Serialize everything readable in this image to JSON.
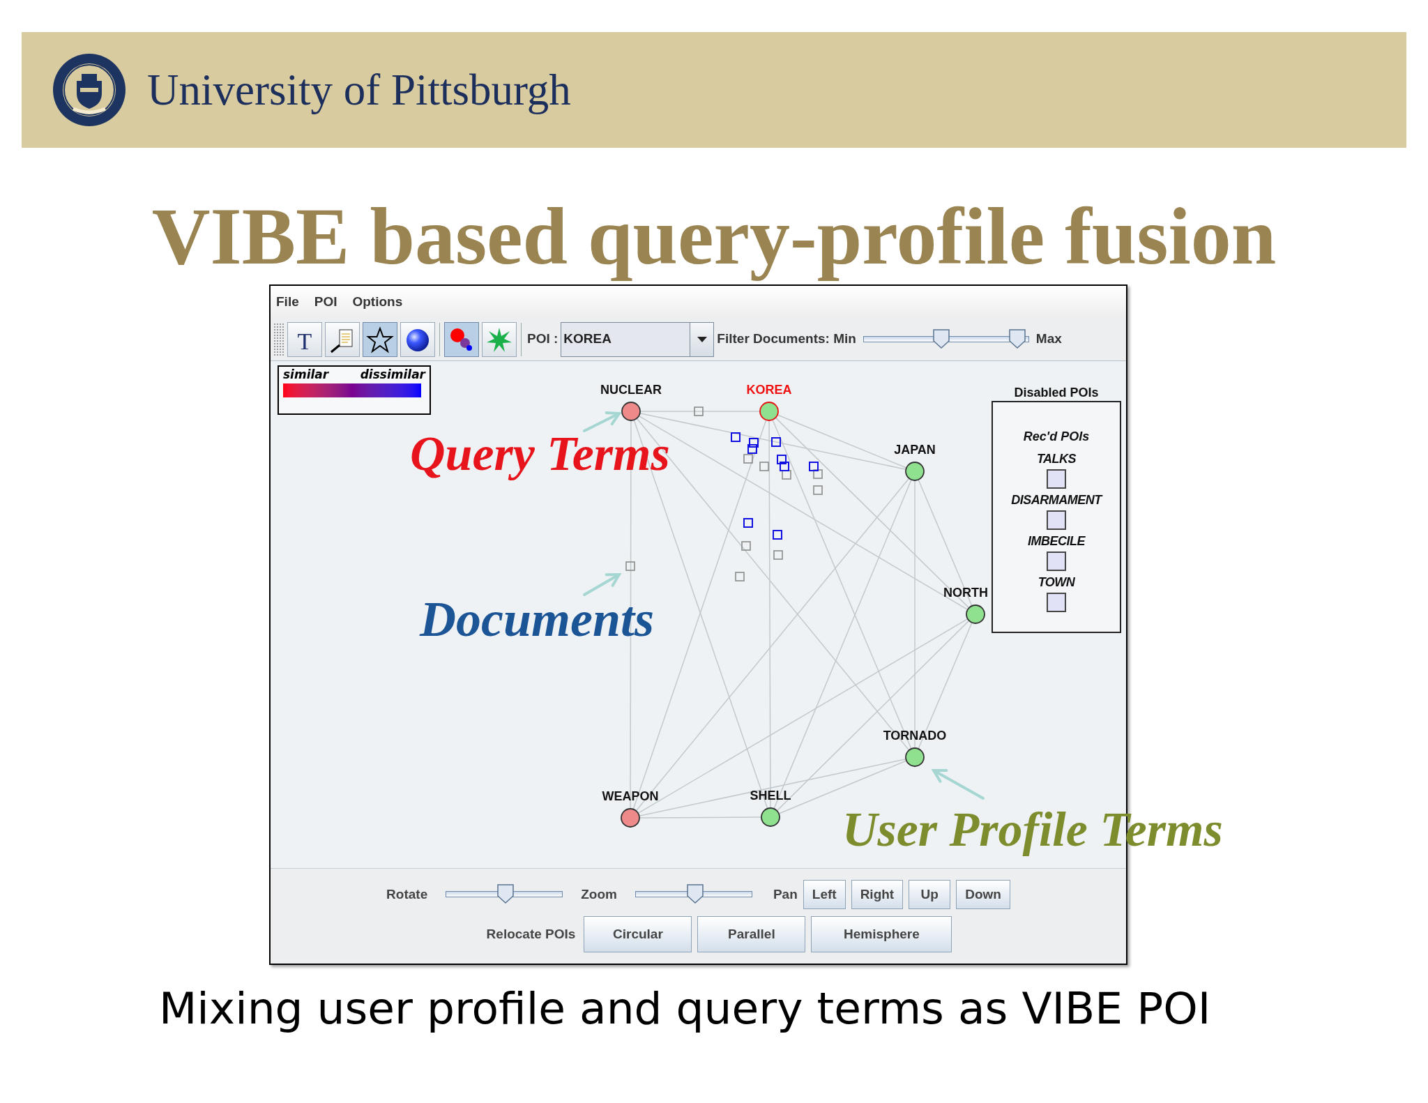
{
  "header": {
    "institution": "University of Pittsburgh"
  },
  "slide_title": "VIBE based query-profile fusion",
  "app": {
    "menu": [
      "File",
      "POI",
      "Options"
    ],
    "toolbar": {
      "tools": [
        {
          "kind": "text",
          "selected": false,
          "glyph": "T"
        },
        {
          "kind": "document",
          "selected": false
        },
        {
          "kind": "star",
          "selected": true
        },
        {
          "kind": "sphere",
          "selected": false
        },
        {
          "kind": "dots",
          "selected": true
        },
        {
          "kind": "burst",
          "selected": false
        }
      ],
      "poi_label": "POI :",
      "poi_value": "KOREA",
      "filter_label": "Filter Documents: Min",
      "filter_max_label": "Max",
      "filter_thumbs": [
        {
          "level": 0.47
        },
        {
          "level": 0.93
        }
      ]
    },
    "legend": {
      "similar": "similar",
      "dissimilar": "dissimilar"
    },
    "pois": [
      {
        "label": "NUCLEAR",
        "kind": "query",
        "selected": false
      },
      {
        "label": "KOREA",
        "kind": "profile",
        "selected": true
      },
      {
        "label": "JAPAN",
        "kind": "profile",
        "selected": false
      },
      {
        "label": "NORTH",
        "kind": "profile",
        "selected": false
      },
      {
        "label": "TORNADO",
        "kind": "profile",
        "selected": false
      },
      {
        "label": "SHELL",
        "kind": "profile",
        "selected": false
      },
      {
        "label": "WEAPON",
        "kind": "query",
        "selected": false
      }
    ],
    "disabled_pois": {
      "title": "Disabled POIs",
      "heading": "Rec'd POIs",
      "items": [
        "TALKS",
        "DISARMAMENT",
        "IMBECILE",
        "TOWN"
      ]
    },
    "controls": {
      "rotate": {
        "label": "Rotate",
        "level": 0.51
      },
      "zoom": {
        "label": "Zoom",
        "level": 0.51
      },
      "pan_label": "Pan",
      "pan_buttons": [
        "Left",
        "Right",
        "Up",
        "Down"
      ],
      "relocate_label": "Relocate POIs",
      "relocate_buttons": [
        "Circular",
        "Parallel",
        "Hemisphere"
      ]
    }
  },
  "annotations": [
    {
      "text": "Query Terms",
      "color": "#e8141b"
    },
    {
      "text": "Documents",
      "color": "#1c5596"
    },
    {
      "text": "User Profile Terms",
      "color": "#7d8c2c"
    }
  ],
  "caption": "Mixing user profile and query terms as VIBE POI"
}
